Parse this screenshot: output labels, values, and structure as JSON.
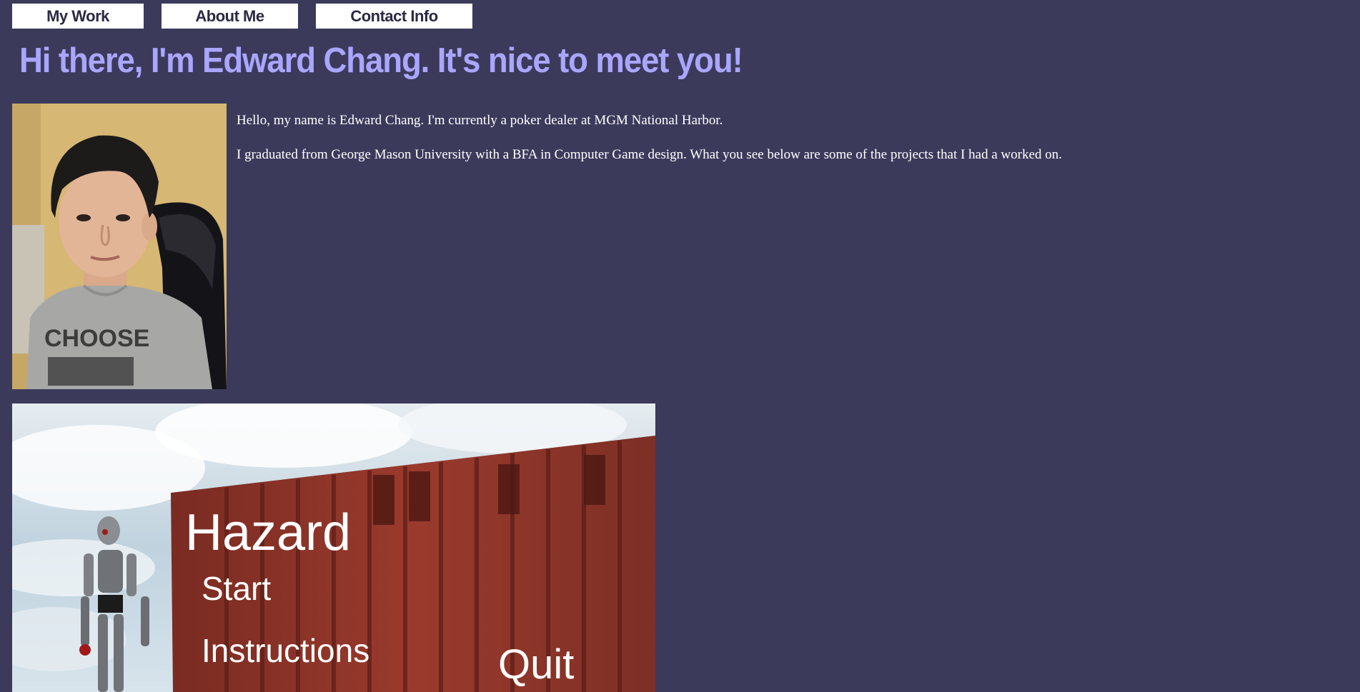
{
  "nav": {
    "items": [
      {
        "label": "My Work"
      },
      {
        "label": "About Me"
      },
      {
        "label": "Contact Info"
      }
    ]
  },
  "header": {
    "title": "Hi there, I'm Edward Chang. It's nice to meet you!"
  },
  "intro": {
    "paragraph_1": "Hello, my name is Edward Chang. I'm currently a poker dealer at MGM National Harbor.",
    "paragraph_2": "I graduated from George Mason University with a BFA in Computer Game design. What you see below are some of the projects that I had a worked on."
  },
  "portrait": {
    "shirt_text": "CHOOSE"
  },
  "project": {
    "game_title": "Hazard",
    "menu": [
      "Start",
      "Instructions",
      "Quit"
    ]
  },
  "colors": {
    "background": "#3c3a5b",
    "heading": "#aaa6ff",
    "nav_bg": "#ffffff",
    "nav_text": "#2b2942"
  }
}
